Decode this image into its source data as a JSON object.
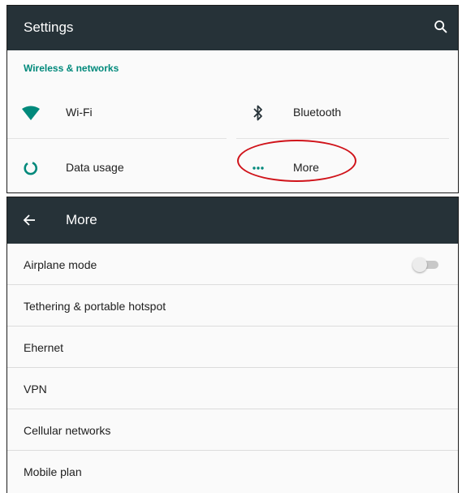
{
  "settings": {
    "title": "Settings",
    "section_label": "Wireless & networks",
    "tiles": [
      {
        "label": "Wi-Fi",
        "icon": "wifi-icon"
      },
      {
        "label": "Bluetooth",
        "icon": "bluetooth-icon"
      },
      {
        "label": "Data usage",
        "icon": "data-usage-icon"
      },
      {
        "label": "More",
        "icon": "more-dots-icon"
      }
    ]
  },
  "more_screen": {
    "title": "More",
    "items": [
      {
        "label": "Airplane mode",
        "toggle_on": false
      },
      {
        "label": "Tethering & portable hotspot"
      },
      {
        "label": "Ehernet"
      },
      {
        "label": "VPN"
      },
      {
        "label": "Cellular networks"
      },
      {
        "label": "Mobile plan"
      }
    ]
  },
  "colors": {
    "toolbar": "#263238",
    "accent": "#00897b",
    "highlight": "#d0131a"
  }
}
